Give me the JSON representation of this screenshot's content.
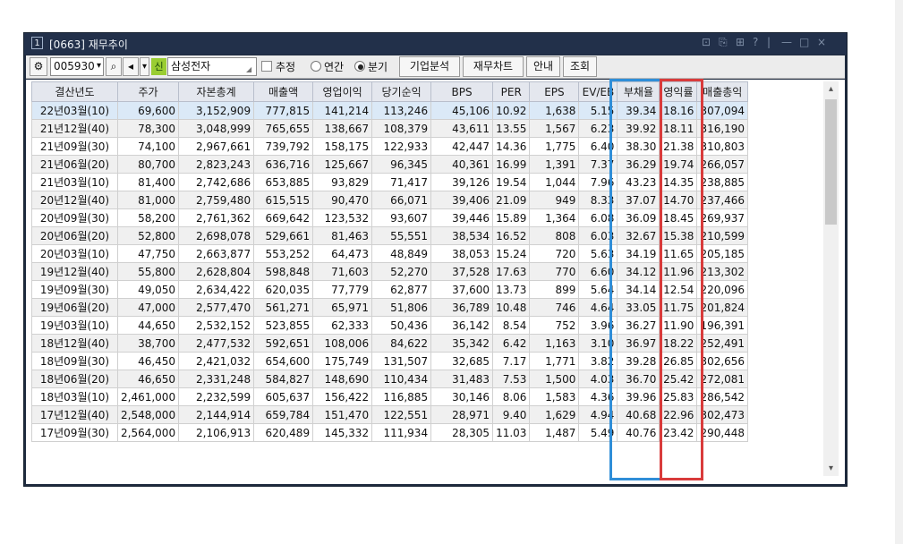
{
  "window": {
    "icon_text": "1",
    "title": "[0663] 재무추이",
    "controls": [
      "⊡",
      "⎘",
      "⊞",
      "?",
      "|",
      "—",
      "□",
      "×"
    ]
  },
  "toolbar": {
    "code": "005930",
    "badge": "신",
    "name": "삼성전자",
    "estimate_label": "추정",
    "annual_label": "연간",
    "quarter_label": "분기",
    "btn_company": "기업분석",
    "btn_chart": "재무차트",
    "btn_guide": "안내",
    "btn_query": "조회"
  },
  "table": {
    "headers": [
      "결산년도",
      "주가",
      "자본총계",
      "매출액",
      "영업이익",
      "당기순익",
      "BPS",
      "PER",
      "EPS",
      "EV/EB",
      "부채율",
      "영익률",
      "매출총익"
    ],
    "rows": [
      [
        "22년03월(10)",
        "69,600",
        "3,152,909",
        "777,815",
        "141,214",
        "113,246",
        "45,106",
        "10.92",
        "1,638",
        "5.15",
        "39.34",
        "18.16",
        "307,094"
      ],
      [
        "21년12월(40)",
        "78,300",
        "3,048,999",
        "765,655",
        "138,667",
        "108,379",
        "43,611",
        "13.55",
        "1,567",
        "6.23",
        "39.92",
        "18.11",
        "316,190"
      ],
      [
        "21년09월(30)",
        "74,100",
        "2,967,661",
        "739,792",
        "158,175",
        "122,933",
        "42,447",
        "14.36",
        "1,775",
        "6.40",
        "38.30",
        "21.38",
        "310,803"
      ],
      [
        "21년06월(20)",
        "80,700",
        "2,823,243",
        "636,716",
        "125,667",
        "96,345",
        "40,361",
        "16.99",
        "1,391",
        "7.37",
        "36.29",
        "19.74",
        "266,057"
      ],
      [
        "21년03월(10)",
        "81,400",
        "2,742,686",
        "653,885",
        "93,829",
        "71,417",
        "39,126",
        "19.54",
        "1,044",
        "7.96",
        "43.23",
        "14.35",
        "238,885"
      ],
      [
        "20년12월(40)",
        "81,000",
        "2,759,480",
        "615,515",
        "90,470",
        "66,071",
        "39,406",
        "21.09",
        "949",
        "8.33",
        "37.07",
        "14.70",
        "237,466"
      ],
      [
        "20년09월(30)",
        "58,200",
        "2,761,362",
        "669,642",
        "123,532",
        "93,607",
        "39,446",
        "15.89",
        "1,364",
        "6.08",
        "36.09",
        "18.45",
        "269,937"
      ],
      [
        "20년06월(20)",
        "52,800",
        "2,698,078",
        "529,661",
        "81,463",
        "55,551",
        "38,534",
        "16.52",
        "808",
        "6.03",
        "32.67",
        "15.38",
        "210,599"
      ],
      [
        "20년03월(10)",
        "47,750",
        "2,663,877",
        "553,252",
        "64,473",
        "48,849",
        "38,053",
        "15.24",
        "720",
        "5.63",
        "34.19",
        "11.65",
        "205,185"
      ],
      [
        "19년12월(40)",
        "55,800",
        "2,628,804",
        "598,848",
        "71,603",
        "52,270",
        "37,528",
        "17.63",
        "770",
        "6.60",
        "34.12",
        "11.96",
        "213,302"
      ],
      [
        "19년09월(30)",
        "49,050",
        "2,634,422",
        "620,035",
        "77,779",
        "62,877",
        "37,600",
        "13.73",
        "899",
        "5.64",
        "34.14",
        "12.54",
        "220,096"
      ],
      [
        "19년06월(20)",
        "47,000",
        "2,577,470",
        "561,271",
        "65,971",
        "51,806",
        "36,789",
        "10.48",
        "746",
        "4.64",
        "33.05",
        "11.75",
        "201,824"
      ],
      [
        "19년03월(10)",
        "44,650",
        "2,532,152",
        "523,855",
        "62,333",
        "50,436",
        "36,142",
        "8.54",
        "752",
        "3.96",
        "36.27",
        "11.90",
        "196,391"
      ],
      [
        "18년12월(40)",
        "38,700",
        "2,477,532",
        "592,651",
        "108,006",
        "84,622",
        "35,342",
        "6.42",
        "1,163",
        "3.10",
        "36.97",
        "18.22",
        "252,491"
      ],
      [
        "18년09월(30)",
        "46,450",
        "2,421,032",
        "654,600",
        "175,749",
        "131,507",
        "32,685",
        "7.17",
        "1,771",
        "3.82",
        "39.28",
        "26.85",
        "302,656"
      ],
      [
        "18년06월(20)",
        "46,650",
        "2,331,248",
        "584,827",
        "148,690",
        "110,434",
        "31,483",
        "7.53",
        "1,500",
        "4.03",
        "36.70",
        "25.42",
        "272,081"
      ],
      [
        "18년03월(10)",
        "2,461,000",
        "2,232,599",
        "605,637",
        "156,422",
        "116,885",
        "30,146",
        "8.06",
        "1,583",
        "4.36",
        "39.96",
        "25.83",
        "286,542"
      ],
      [
        "17년12월(40)",
        "2,548,000",
        "2,144,914",
        "659,784",
        "151,470",
        "122,551",
        "28,971",
        "9.40",
        "1,629",
        "4.94",
        "40.68",
        "22.96",
        "302,473"
      ],
      [
        "17년09월(30)",
        "2,564,000",
        "2,106,913",
        "620,489",
        "145,332",
        "111,934",
        "28,305",
        "11.03",
        "1,487",
        "5.49",
        "40.76",
        "23.42",
        "290,448"
      ]
    ]
  },
  "icons": {
    "settings": "⚙",
    "dropdown": "▾",
    "search": "⌕",
    "speaker": "◂",
    "resize": "◢",
    "scroll_up": "▴",
    "scroll_down": "▾"
  },
  "colors": {
    "title_bar": "#22304a",
    "highlight_eps": "#2f8ed8",
    "highlight_evebitda": "#d93b3b",
    "red_text": "#c22222",
    "selected_row": "#dbe9f7"
  }
}
